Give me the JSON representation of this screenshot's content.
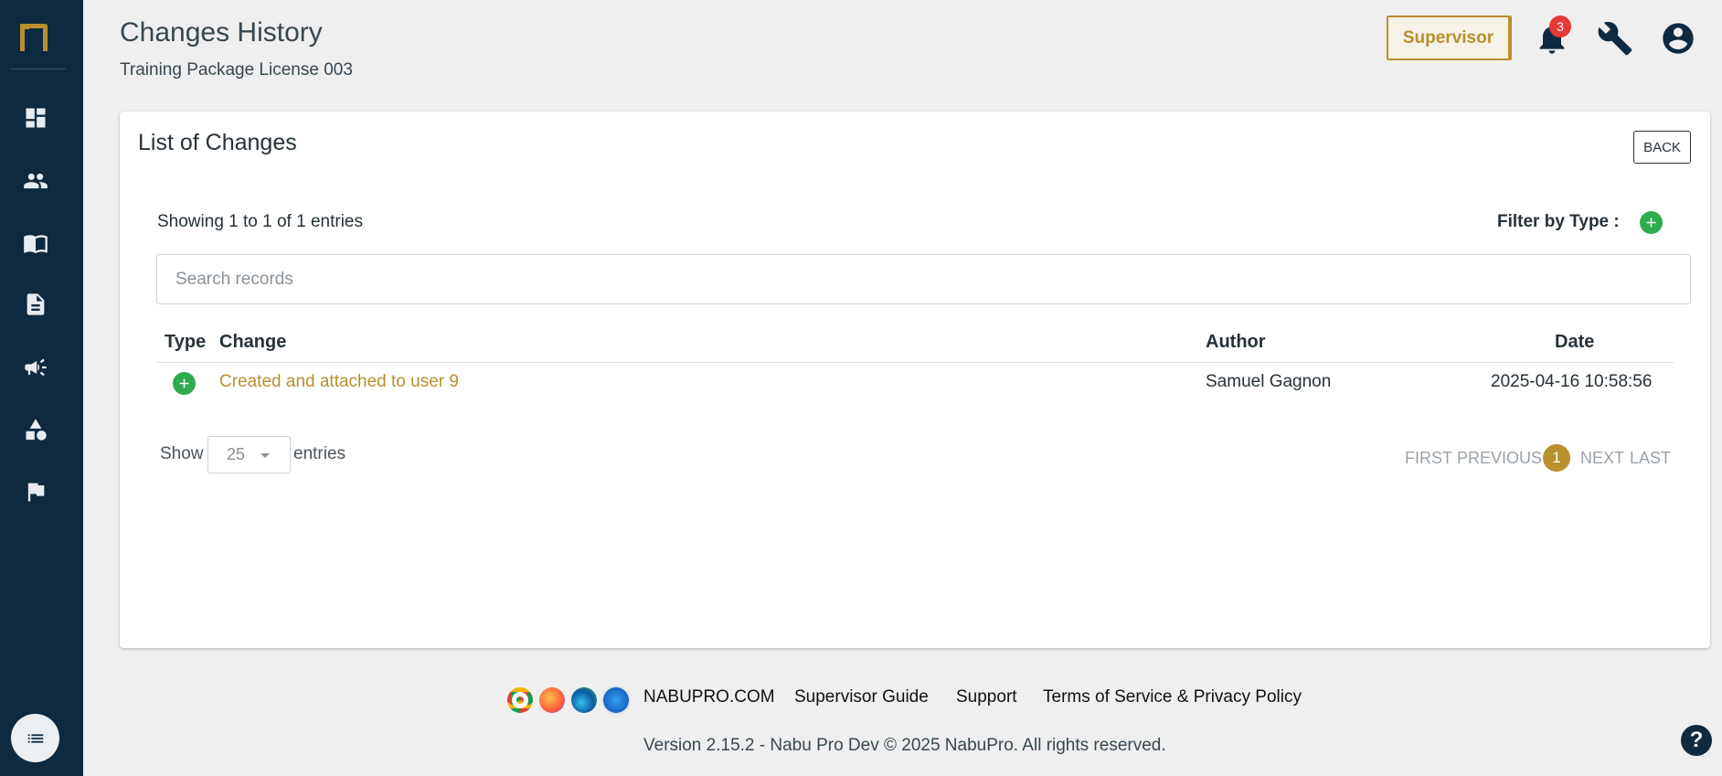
{
  "header": {
    "title": "Changes History",
    "subtitle": "Training Package License 003",
    "role_label": "Supervisor",
    "notification_count": "3"
  },
  "sidebar": {
    "items": [
      {
        "icon": "dashboard-icon"
      },
      {
        "icon": "users-icon"
      },
      {
        "icon": "book-icon"
      },
      {
        "icon": "document-icon"
      },
      {
        "icon": "campaign-icon"
      },
      {
        "icon": "shapes-icon"
      },
      {
        "icon": "flag-icon"
      }
    ]
  },
  "card": {
    "title": "List of Changes",
    "back_label": "BACK",
    "showing_text": "Showing 1 to 1 of 1 entries",
    "filter_label": "Filter by Type :",
    "search_placeholder": "Search records",
    "columns": [
      "Type",
      "Change",
      "Author",
      "Date"
    ],
    "rows": [
      {
        "type_icon": "plus-circle-icon",
        "change": "Created and attached to user 9",
        "author": "Samuel Gagnon",
        "date": "2025-04-16 10:58:56"
      }
    ],
    "show_label": "Show",
    "page_size": "25",
    "entries_label": "entries",
    "pagination": {
      "first": "FIRST",
      "previous": "PREVIOUS",
      "current": "1",
      "next": "NEXT",
      "last": "LAST"
    }
  },
  "footer": {
    "links": [
      "NABUPRO.COM",
      "Supervisor Guide",
      "Support",
      "Terms of Service & Privacy Policy"
    ],
    "version": "Version 2.15.2 - Nabu Pro Dev © 2025 NabuPro. All rights reserved.",
    "help": "?"
  },
  "colors": {
    "sidebar": "#0e2a40",
    "accent": "#b8902e",
    "add": "#2eaa4f",
    "badge": "#e53935"
  }
}
